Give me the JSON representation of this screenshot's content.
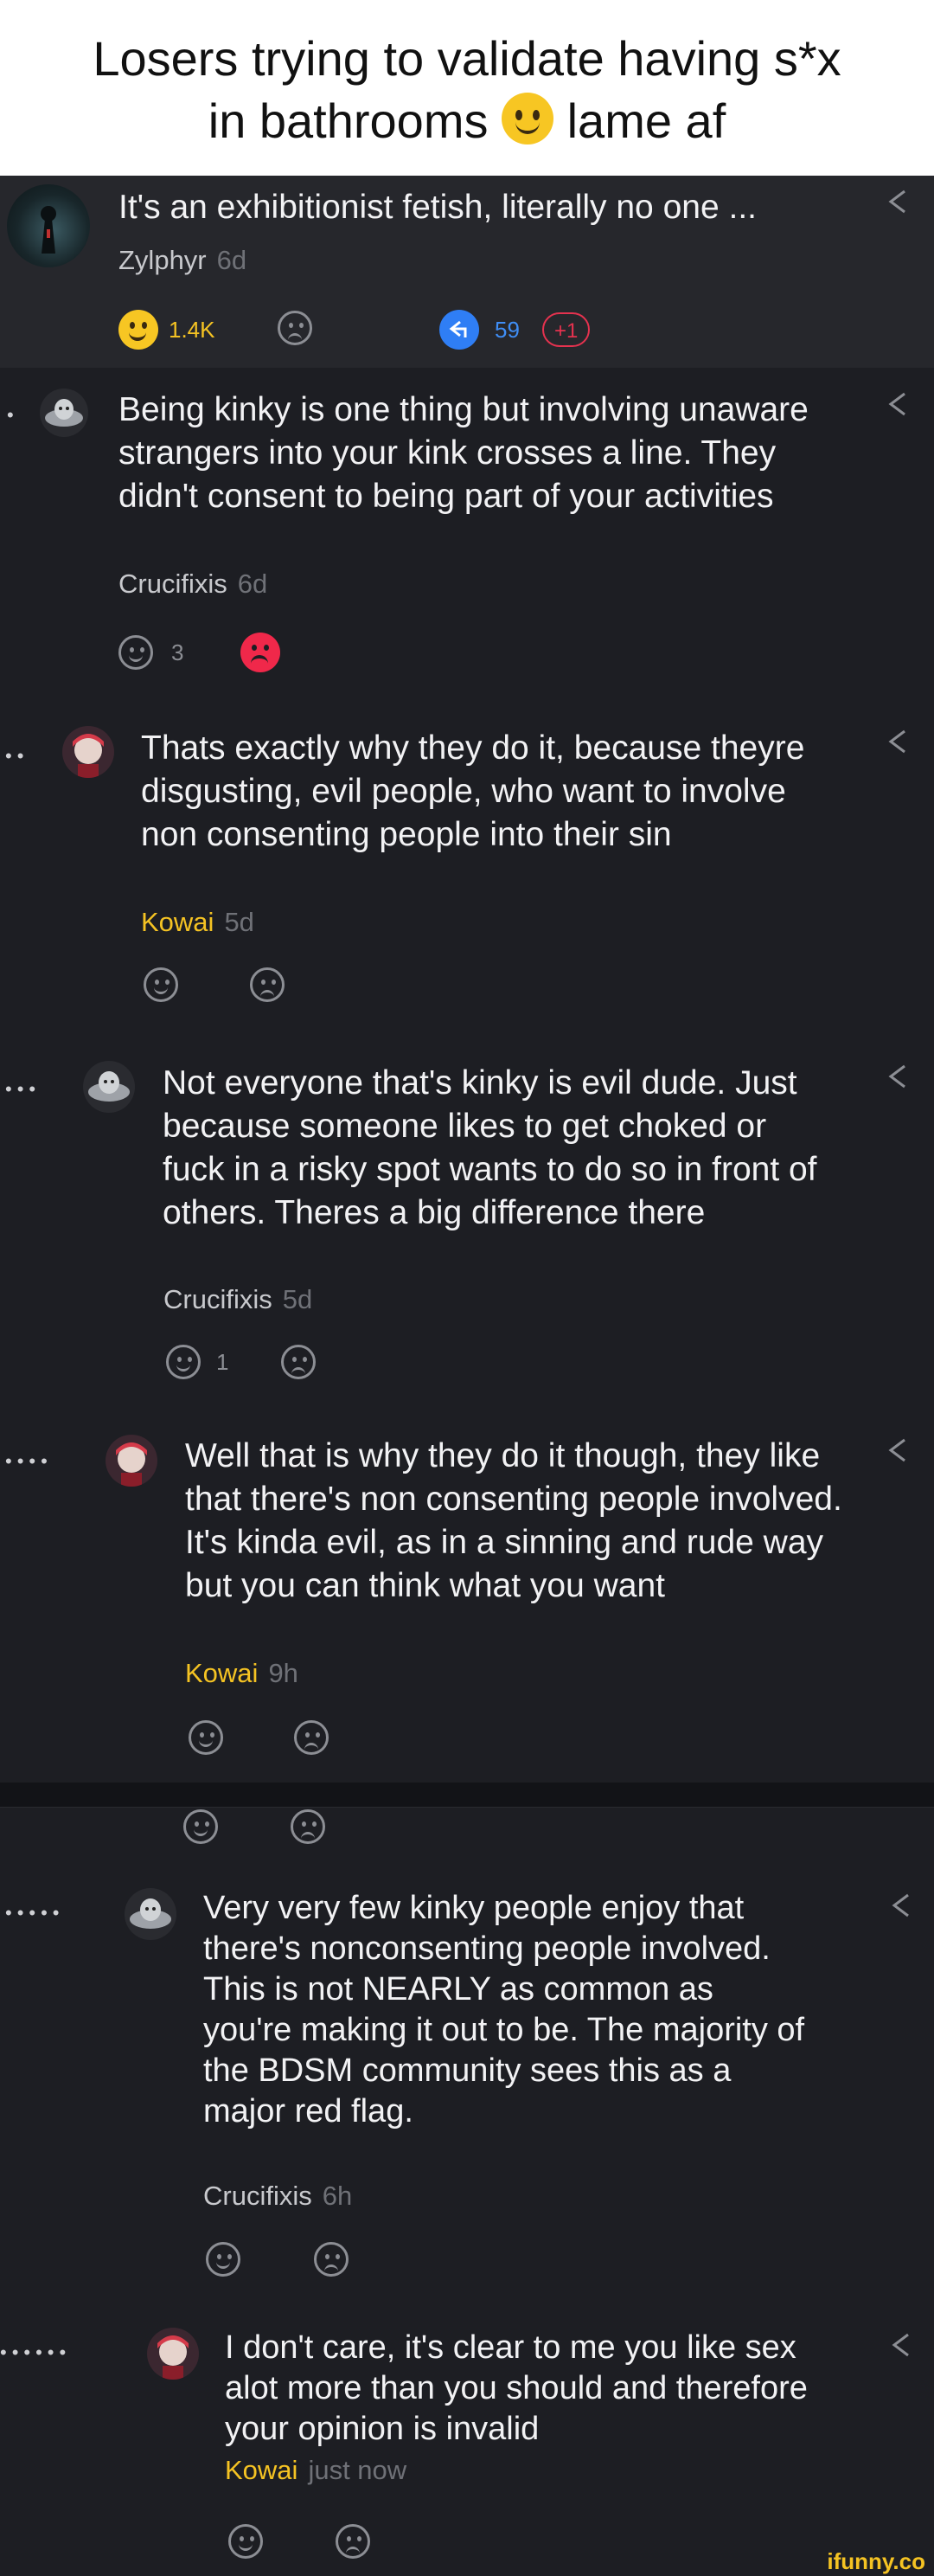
{
  "meme": {
    "line1": "Losers trying to validate having s*x",
    "line2_pre": "in bathrooms",
    "line2_post": "lame af"
  },
  "comments": [
    {
      "text": "It's an exhibitionist fetish, literally no one ...",
      "user": "Zylphyr",
      "time": "6d",
      "likes": "1.4K",
      "replies": "59",
      "badge": "+1"
    },
    {
      "text": "Being kinky is one thing but involving unaware strangers into your kink crosses a line. They didn't consent to being part of your activities",
      "user": "Crucifixis",
      "time": "6d",
      "likes": "3"
    },
    {
      "text": "Thats exactly why they do it, because theyre disgusting, evil people, who want to involve non consenting people into their sin",
      "user": "Kowai",
      "time": "5d"
    },
    {
      "text": "Not everyone that's kinky is evil dude. Just because someone likes to get choked or fuck in a risky spot wants to do so in front of others. Theres a big difference there",
      "user": "Crucifixis",
      "time": "5d",
      "likes": "1"
    },
    {
      "text": "Well that is why they do it though, they like that there's non consenting people involved. It's kinda evil, as in a sinning and rude way but you can think what you want",
      "user": "Kowai",
      "time": "9h"
    },
    {
      "text": "Very very few kinky people enjoy that there's nonconsenting people involved. This is not NEARLY as common as you're making it out to be. The majority of the BDSM community sees this as a major red flag.",
      "user": "Crucifixis",
      "time": "6h"
    },
    {
      "text": "I don't care, it's clear to me you like sex alot more than you should and therefore your opinion is invalid",
      "user": "Kowai",
      "time": "just now"
    }
  ],
  "colors": {
    "background": "#1d1e23",
    "kowai": "#f5c323",
    "reply_blue": "#2f7ef5",
    "dislike_red": "#f0284a"
  },
  "watermark": "ifunny.co"
}
